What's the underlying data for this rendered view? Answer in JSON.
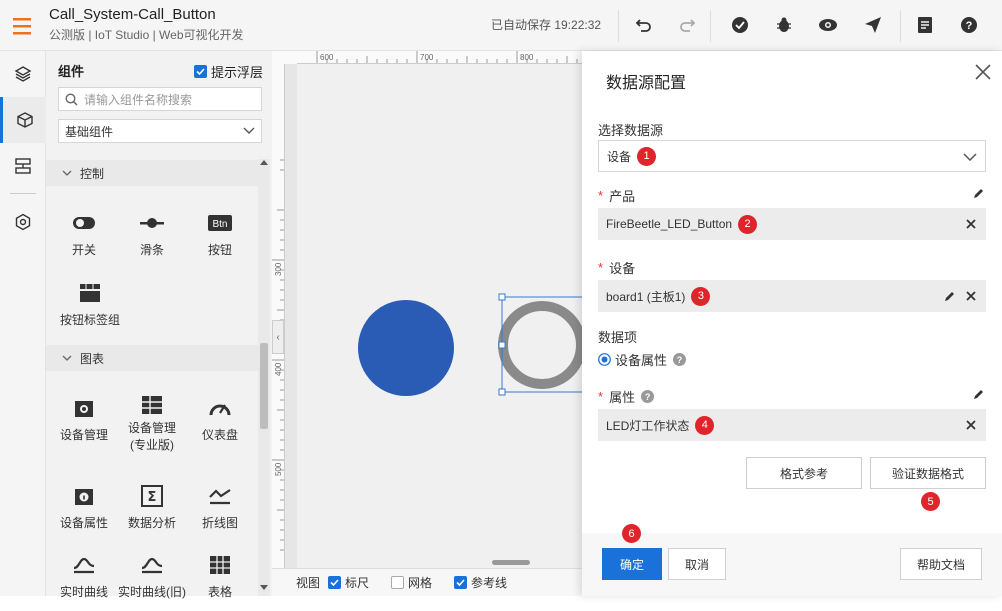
{
  "header": {
    "title": "Call_System-Call_Button",
    "subtitle": "公测版 | IoT Studio | Web可视化开发",
    "autosave": "已自动保存 19:22:32",
    "icons": [
      "undo-icon",
      "redo-icon",
      "check-icon",
      "bug-icon",
      "preview-icon",
      "publish-icon",
      "doc-icon",
      "help-icon"
    ]
  },
  "leftnav": {
    "items": [
      "layers-icon",
      "component-icon",
      "data-icon",
      "settings-icon"
    ],
    "active": 1
  },
  "panel": {
    "title": "组件",
    "show_float_label": "提示浮层",
    "search_placeholder": "请输入组件名称搜索",
    "category": "基础组件",
    "sections": [
      {
        "label": "控制",
        "items": [
          "开关",
          "滑条",
          "按钮",
          "按钮标签组"
        ]
      },
      {
        "label": "图表",
        "items": [
          "设备管理",
          "设备管理\n(专业版)",
          "仪表盘",
          "设备属性",
          "数据分析",
          "折线图",
          "实时曲线",
          "实时曲线(旧)",
          "表格"
        ]
      }
    ],
    "btn_icon_text": "Btn"
  },
  "canvas": {
    "ruler_top": [
      "600",
      "700",
      "800"
    ],
    "ruler_left": [
      "300",
      "400",
      "500"
    ],
    "bottom": {
      "view": "视图",
      "ruler": "标尺",
      "grid": "网格",
      "guides": "参考线"
    },
    "shapes": {
      "circle_color": "#2a5cb5",
      "ring_color": "#8a8a8a"
    }
  },
  "dialog": {
    "title": "数据源配置",
    "source_label": "选择数据源",
    "source_value": "设备",
    "product_label": "产品",
    "product_value": "FireBeetle_LED_Button",
    "device_label": "设备",
    "device_value": "board1 (主板1)",
    "dataitem_label": "数据项",
    "dataitem_option": "设备属性",
    "attr_label": "属性",
    "attr_value": "LED灯工作状态",
    "format_ref": "格式参考",
    "validate": "验证数据格式",
    "confirm": "确定",
    "cancel": "取消",
    "help_doc": "帮助文档",
    "badges": [
      "1",
      "2",
      "3",
      "4",
      "5",
      "6"
    ],
    "required_mark": "*",
    "question_mark": "?"
  },
  "colors": {
    "accent": "#1a71d9",
    "badge": "#e0242b",
    "menu": "#f07020"
  }
}
